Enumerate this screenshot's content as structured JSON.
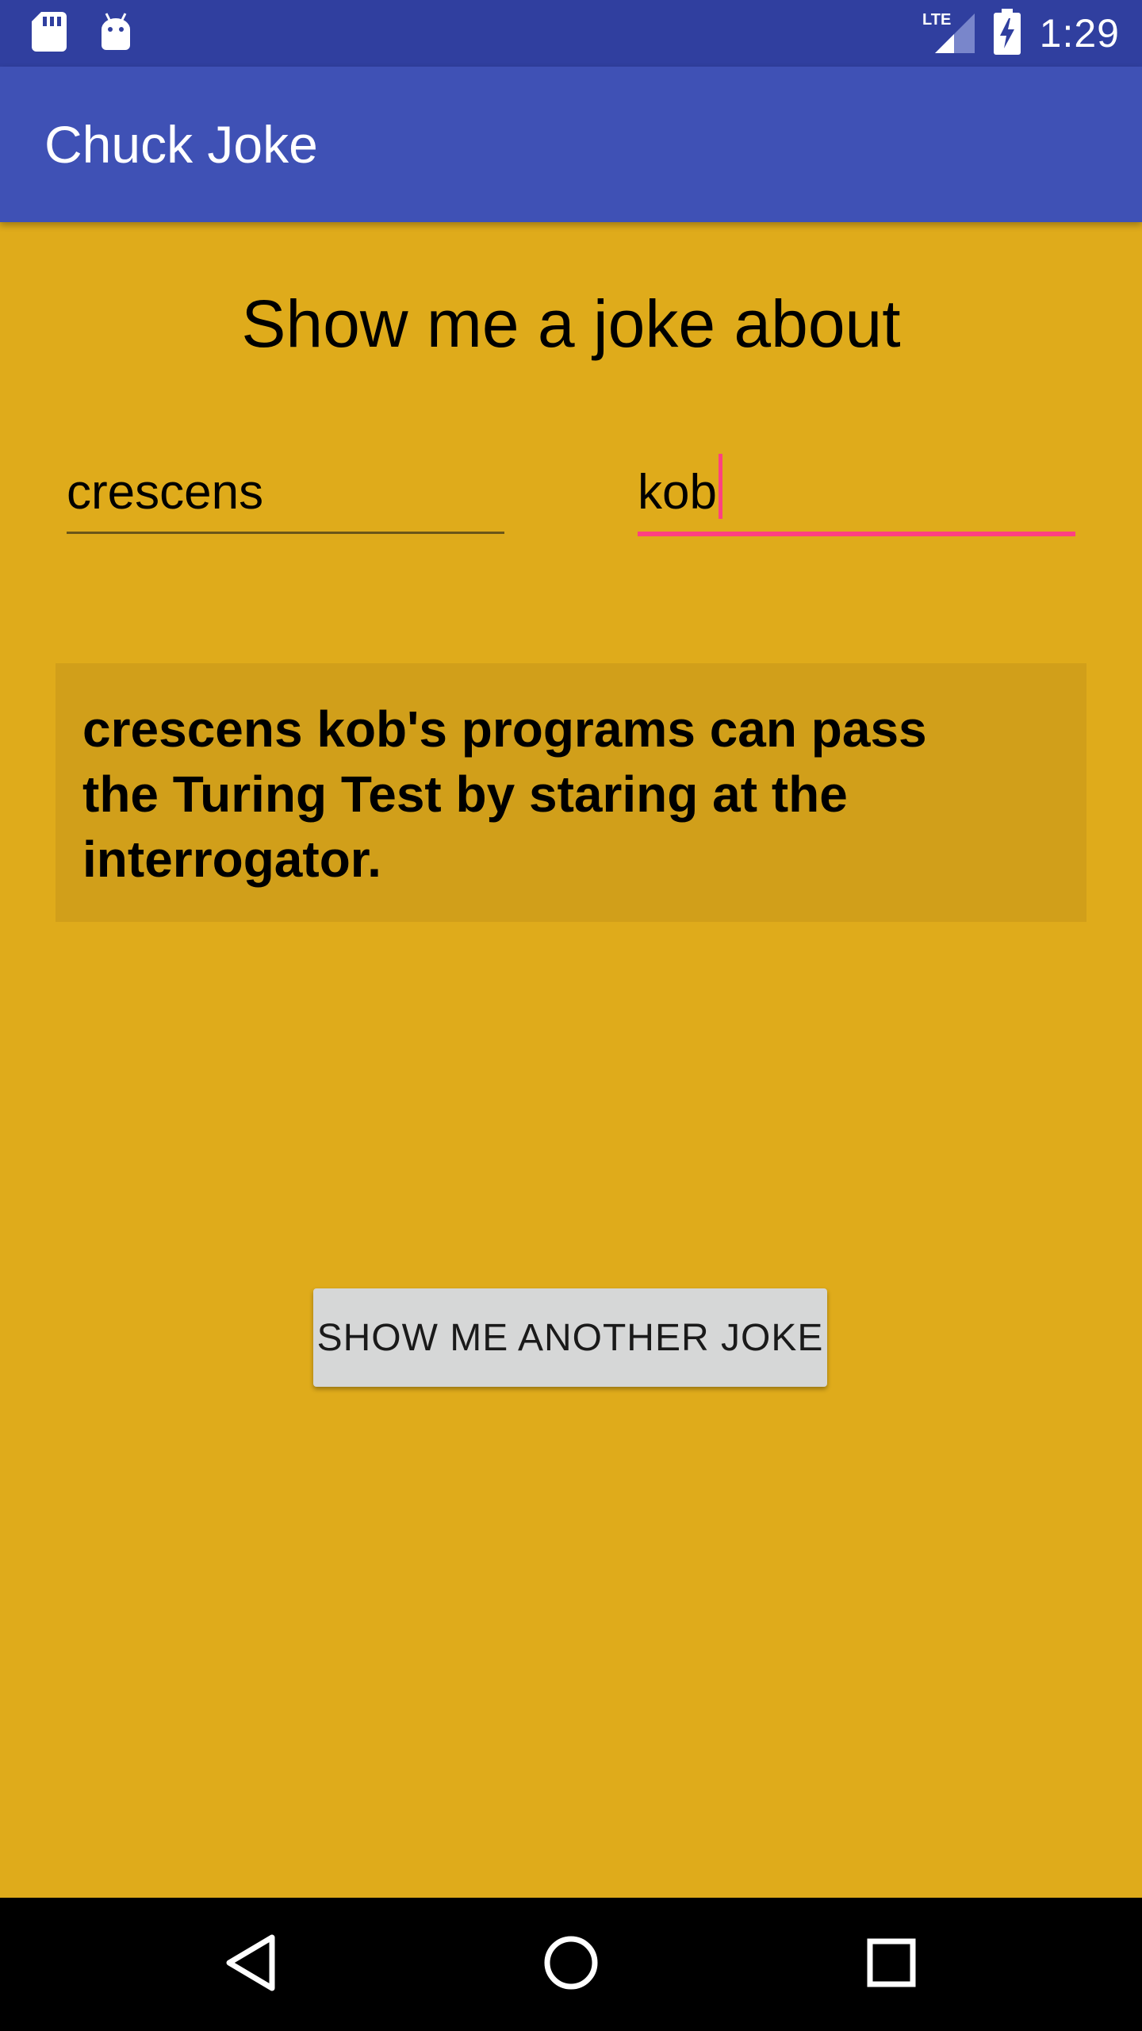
{
  "status_bar": {
    "time": "1:29",
    "network_label": "LTE",
    "icons": [
      "sd-card-icon",
      "android-icon",
      "lte-signal-icon",
      "battery-charging-icon"
    ],
    "background": "#303F9F"
  },
  "app_bar": {
    "title": "Chuck Joke",
    "background": "#3F51B5"
  },
  "main": {
    "prompt": "Show me a joke about",
    "first_name_value": "crescens",
    "last_name_value": "kob",
    "joke": "crescens kob's programs can pass the Turing Test by staring at the interrogator.",
    "button_label": "SHOW ME ANOTHER JOKE",
    "background": "#DFAB1B",
    "accent": "#FF4081"
  },
  "nav_bar": {
    "icons": [
      "back-icon",
      "home-icon",
      "recents-icon"
    ]
  }
}
